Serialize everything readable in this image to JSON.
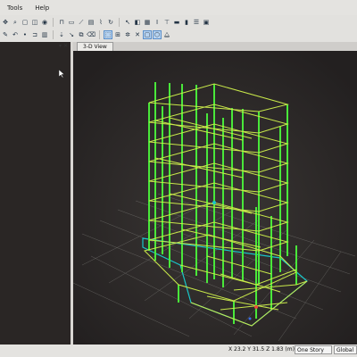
{
  "menu": {
    "items": [
      "Tools",
      "Help"
    ]
  },
  "toolbar1": {
    "icons": [
      "pan-icon",
      "zoom-icon",
      "select-icon",
      "rubber-band-icon",
      "node-icon",
      "frame-icon",
      "wall-icon",
      "brace-icon",
      "area-icon",
      "link-icon",
      "refresh-icon",
      "pointer-icon",
      "section-icon",
      "grid-icon",
      "text-icon",
      "filter-icon",
      "beam-icon",
      "column-icon"
    ]
  },
  "toolbar2": {
    "icons": [
      "draw-icon",
      "undo-icon",
      "node-draw-icon",
      "frame-draw-icon",
      "chart-icon",
      "load-icon",
      "move-icon",
      "copy-icon",
      "erase-icon",
      "object-icon",
      "select-all-icon",
      "snap-icon",
      "x-snap-icon",
      "plan-icon",
      "3d-icon",
      "elevation-icon"
    ]
  },
  "tab": {
    "label": "3-D View",
    "close": "×"
  },
  "leftPanel": {
    "controls": "▾ ✕"
  },
  "status": {
    "coords": "X 23.2  Y 31.5  Z 1.83 (m)",
    "story": "One Story",
    "coord_system": "Global"
  },
  "colors": {
    "frame": "#49e83a",
    "beam": "#c8e84a",
    "grid": "#7a7a78",
    "base": "#19c6c9",
    "bg": "#2e2b2a"
  }
}
